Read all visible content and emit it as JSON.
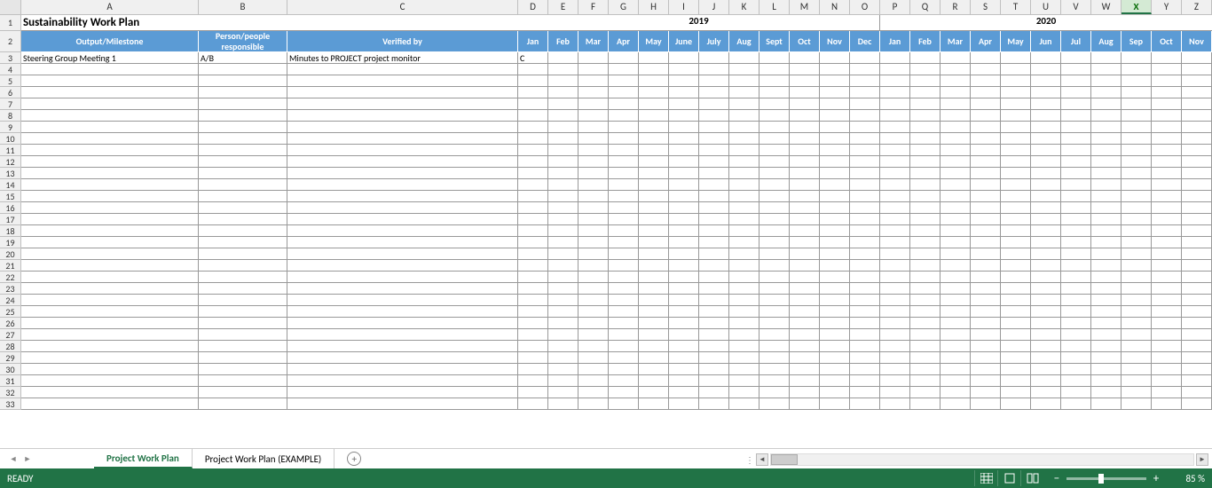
{
  "columns": [
    "A",
    "B",
    "C",
    "D",
    "E",
    "F",
    "G",
    "H",
    "I",
    "J",
    "K",
    "L",
    "M",
    "N",
    "O",
    "P",
    "Q",
    "R",
    "S",
    "T",
    "U",
    "V",
    "W",
    "X",
    "Y",
    "Z"
  ],
  "selected_column": "X",
  "title": "Sustainability Work Plan",
  "years": {
    "y2019": "2019",
    "y2020": "2020"
  },
  "headers": {
    "output": "Output/Milestone",
    "person": "Person/people responsible",
    "verified": "Verified by",
    "months": [
      "Jan",
      "Feb",
      "Mar",
      "Apr",
      "May",
      "June",
      "July",
      "Aug",
      "Sept",
      "Oct",
      "Nov",
      "Dec",
      "Jan",
      "Feb",
      "Mar",
      "Apr",
      "May",
      "Jun",
      "Jul",
      "Aug",
      "Sep",
      "Oct",
      "Nov"
    ]
  },
  "data_row": {
    "a": "Steering Group Meeting 1",
    "b": "A/B",
    "c": "Minutes to PROJECT project monitor",
    "d": "C"
  },
  "tabs": {
    "active": "Project Work Plan",
    "other": "Project Work Plan (EXAMPLE)"
  },
  "status": {
    "ready": "READY",
    "zoom": "85 %"
  }
}
